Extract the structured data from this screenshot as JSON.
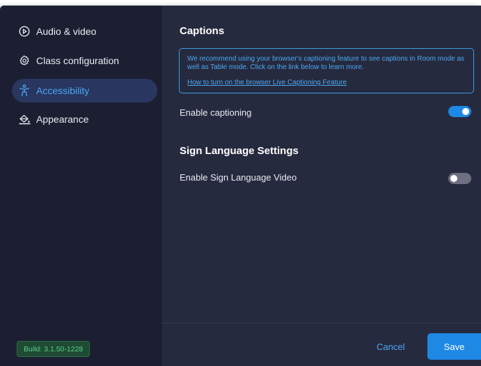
{
  "sidebar": {
    "items": [
      {
        "label": "Audio & video",
        "icon": "play-circle-icon"
      },
      {
        "label": "Class configuration",
        "icon": "gear-icon"
      },
      {
        "label": "Accessibility",
        "icon": "accessibility-person-icon",
        "active": true
      },
      {
        "label": "Appearance",
        "icon": "paint-bucket-icon"
      }
    ],
    "build": "Build: 3.1.50-1228"
  },
  "main": {
    "captions": {
      "title": "Captions",
      "info_text": "We recommend using your browser's captioning feature to see captions in Room mode as well as Table mode. Click on the link below to learn more.",
      "info_link": "How to turn on the browser Live Captioning Feature",
      "enable_label": "Enable captioning",
      "enable_value": true
    },
    "sign_language": {
      "title": "Sign Language Settings",
      "enable_label": "Enable Sign Language Video",
      "enable_value": false
    }
  },
  "footer": {
    "cancel_label": "Cancel",
    "save_label": "Save"
  },
  "colors": {
    "accent": "#1e88e5",
    "link": "#4aa8f2",
    "sidebar_bg": "#1c1f32",
    "panel_bg": "#262a3e",
    "active_item_bg": "#283660",
    "build_badge_text": "#58d08c"
  }
}
